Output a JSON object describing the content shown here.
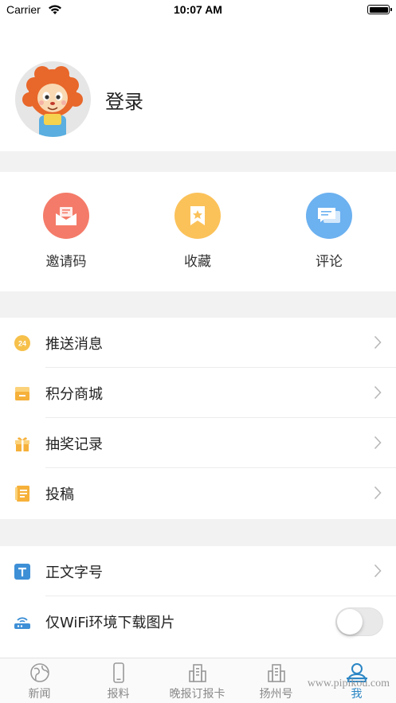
{
  "status_bar": {
    "carrier": "Carrier",
    "time": "10:07 AM"
  },
  "profile": {
    "login_label": "登录"
  },
  "quick_actions": [
    {
      "label": "邀请码",
      "icon": "envelope-icon",
      "color": "#f47b69"
    },
    {
      "label": "收藏",
      "icon": "bookmark-star-icon",
      "color": "#fbc25a"
    },
    {
      "label": "评论",
      "icon": "chat-bubble-icon",
      "color": "#6cb1f0"
    }
  ],
  "menu_group_1": [
    {
      "label": "推送消息",
      "icon": "clock-24-icon"
    },
    {
      "label": "积分商城",
      "icon": "store-icon"
    },
    {
      "label": "抽奖记录",
      "icon": "gift-icon"
    },
    {
      "label": "投稿",
      "icon": "notebook-icon"
    }
  ],
  "menu_group_2": [
    {
      "label": "正文字号",
      "icon": "text-size-icon"
    },
    {
      "label": "仅WiFi环境下载图片",
      "icon": "wifi-router-icon",
      "toggle_on": false
    }
  ],
  "tabs": [
    {
      "label": "新闻",
      "icon": "globe-icon",
      "active": false
    },
    {
      "label": "报料",
      "icon": "phone-icon",
      "active": false
    },
    {
      "label": "晚报订报卡",
      "icon": "building-icon",
      "active": false
    },
    {
      "label": "扬州号",
      "icon": "building-icon",
      "active": false
    },
    {
      "label": "我",
      "icon": "person-icon",
      "active": true
    }
  ],
  "watermark": "www.pipikou.com",
  "colors": {
    "accent": "#2b86c5",
    "separator": "#f2f2f2"
  }
}
